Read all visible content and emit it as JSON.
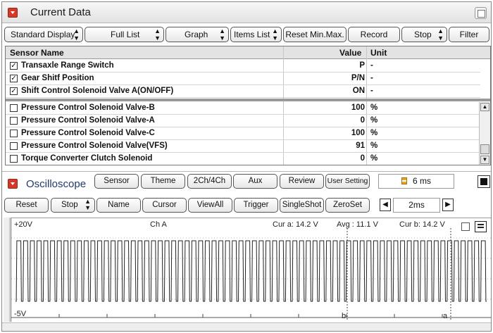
{
  "current_data": {
    "title": "Current Data",
    "toolbar": {
      "standard_display": "Standard Display",
      "full_list": "Full List",
      "graph": "Graph",
      "items_list": "Items List",
      "reset_minmax": "Reset Min.Max.",
      "record": "Record",
      "stop": "Stop",
      "filter": "Filter"
    },
    "columns": {
      "sensor_name": "Sensor Name",
      "value": "Value",
      "unit": "Unit"
    },
    "rows": [
      {
        "name": "Transaxle Range Switch",
        "value": "P",
        "unit": "-",
        "checked": true
      },
      {
        "name": "Gear Shitf Position",
        "value": "P/N",
        "unit": "-",
        "checked": true
      },
      {
        "name": "Shift Control Solenoid Valve A(ON/OFF)",
        "value": "ON",
        "unit": "-",
        "checked": true
      },
      {
        "name": "Pressure Control Solenoid Valve-B",
        "value": "100",
        "unit": "%",
        "checked": false
      },
      {
        "name": "Pressure Control Solenoid Valve-A",
        "value": "0",
        "unit": "%",
        "checked": false
      },
      {
        "name": "Pressure Control Solenoid Valve-C",
        "value": "100",
        "unit": "%",
        "checked": false
      },
      {
        "name": "Pressure Control Solenoid Valve(VFS)",
        "value": "91",
        "unit": "%",
        "checked": false
      },
      {
        "name": "Torque Converter Clutch Solenoid",
        "value": "0",
        "unit": "%",
        "checked": false
      }
    ]
  },
  "oscilloscope": {
    "title": "Oscilloscope",
    "buttons": {
      "sensor": "Sensor",
      "theme": "Theme",
      "ch": "2Ch/4Ch",
      "aux": "Aux",
      "review": "Review",
      "user_setting": "User Setting",
      "reset": "Reset",
      "stop": "Stop",
      "name": "Name",
      "cursor": "Cursor",
      "viewall": "ViewAll",
      "trigger": "Trigger",
      "singleshot": "SingleShot",
      "zeroset": "ZeroSet"
    },
    "sample_time": "6 ms",
    "time_div": "2ms",
    "scope": {
      "vmax": "+20V",
      "vmin": "-5V",
      "channel": "Ch A",
      "cur_a": "Cur a: 14.2 V",
      "avg": "Avg : 11.1 V",
      "cur_b": "Cur b: 14.2 V",
      "cursor_a": "a",
      "cursor_b": "b",
      "pulse_count": 70
    }
  },
  "icons": {
    "collapse": "collapse-arrow-icon",
    "window": "window-toggle-icon",
    "hourglass": "hourglass-icon",
    "prev": "triangle-left-icon",
    "next": "triangle-right-icon",
    "stop": "stop-square-icon",
    "scope_view": "scope-layout-icon"
  },
  "colors": {
    "accent_red": "#d43a2a",
    "title_blue": "#1f3a6d"
  }
}
